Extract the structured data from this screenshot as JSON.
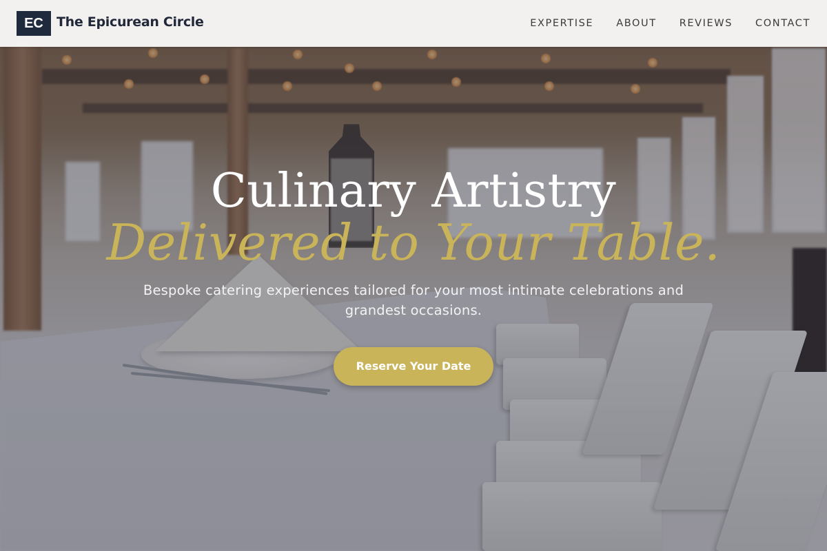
{
  "brand": {
    "logo_initials": "EC",
    "name": "The Epicurean Circle"
  },
  "nav": {
    "items": [
      {
        "label": "EXPERTISE"
      },
      {
        "label": "ABOUT"
      },
      {
        "label": "REVIEWS"
      },
      {
        "label": "CONTACT"
      }
    ]
  },
  "hero": {
    "title": "Culinary Artistry",
    "subtitle": "Delivered to Your Table.",
    "description": "Bespoke catering experiences tailored for your most intimate celebrations and grandest occasions.",
    "cta_label": "Reserve Your Date"
  },
  "colors": {
    "accent_gold": "#c9b45a",
    "brand_navy": "#202a3d",
    "nav_background": "#f8f7f5"
  }
}
